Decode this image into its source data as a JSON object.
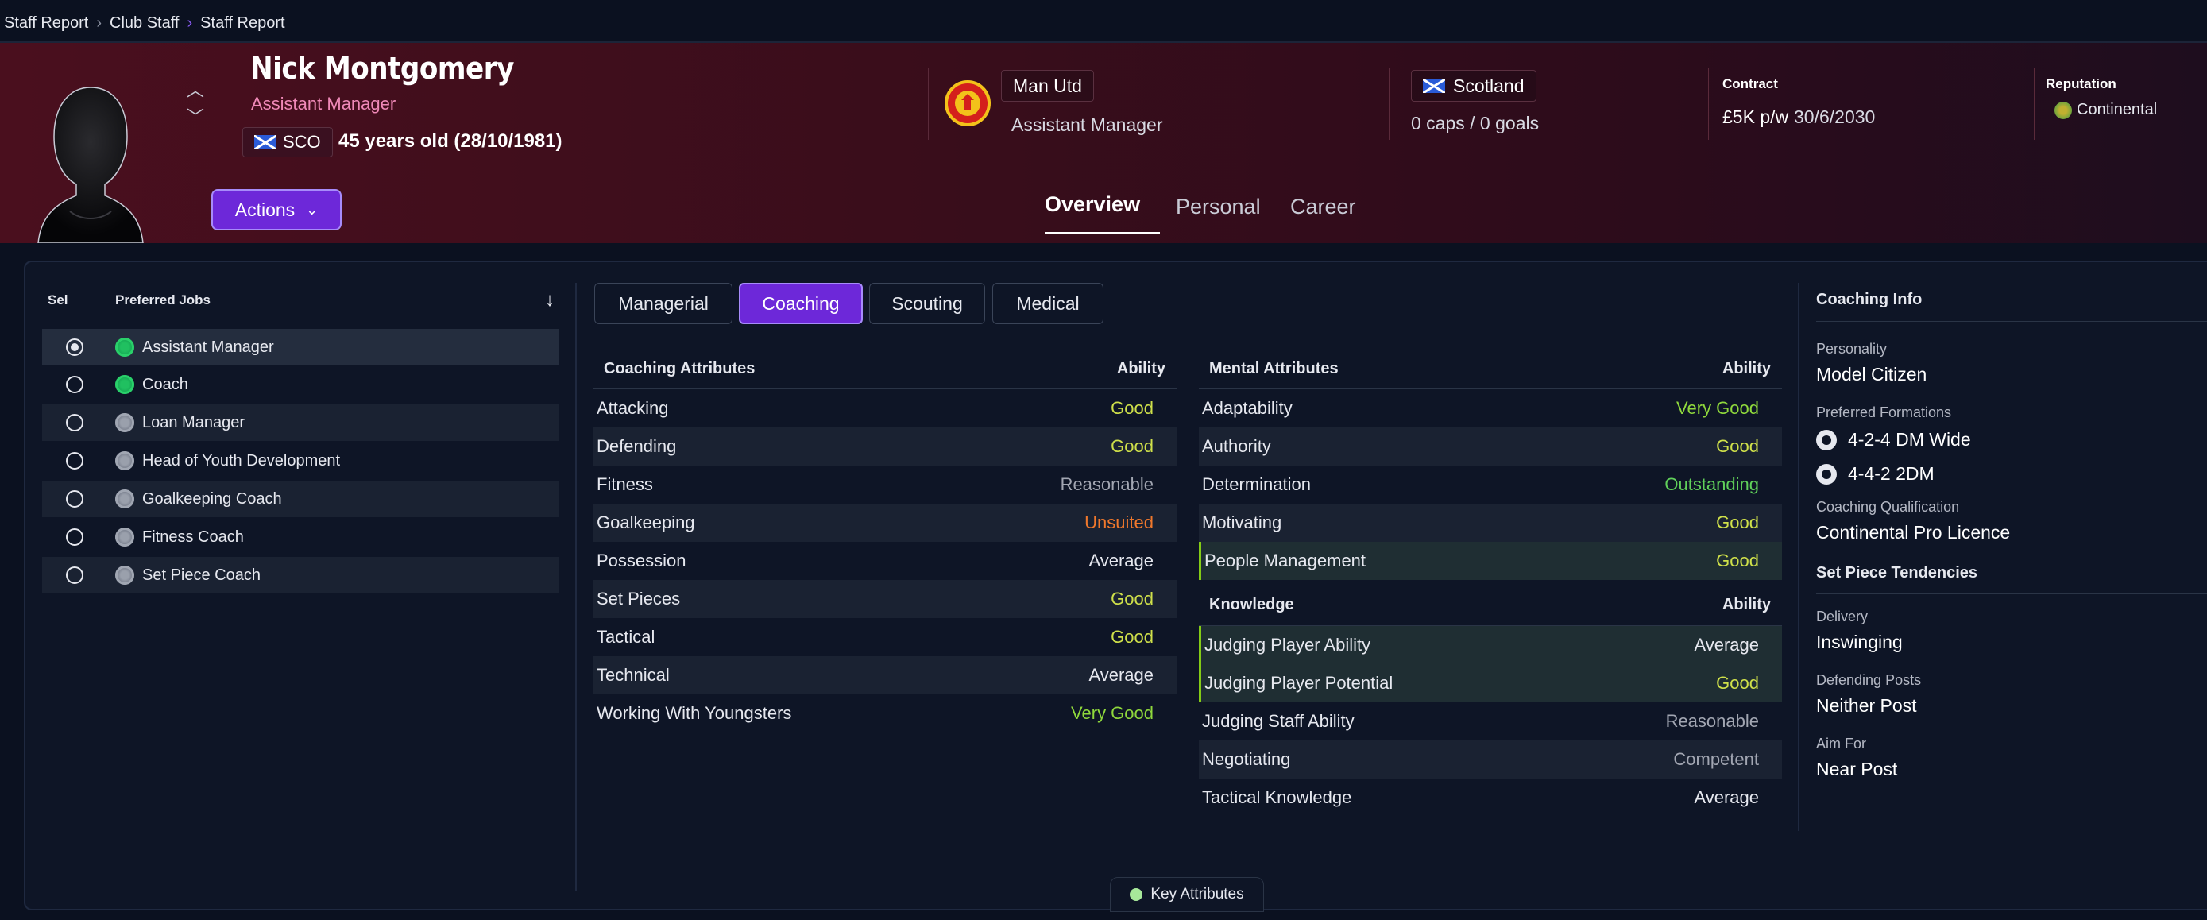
{
  "breadcrumb": [
    "Staff Report",
    "Club Staff",
    "Staff Report"
  ],
  "header": {
    "name": "Nick Montgomery",
    "role": "Assistant Manager",
    "nationality_code": "SCO",
    "age": "45 years old (28/10/1981)",
    "actions_label": "Actions",
    "club": "Man Utd",
    "club_role": "Assistant Manager",
    "nation": "Scotland",
    "caps": "0 caps / 0 goals",
    "contract_label": "Contract",
    "contract_wage": "£5K p/w",
    "contract_expiry": "30/6/2030",
    "reputation_label": "Reputation",
    "reputation": "Continental"
  },
  "tabs": [
    "Overview",
    "Personal",
    "Career"
  ],
  "jobs": {
    "col_sel": "Sel",
    "col_jobs": "Preferred Jobs",
    "items": [
      {
        "label": "Assistant Manager",
        "selected": true,
        "suited": true
      },
      {
        "label": "Coach",
        "selected": false,
        "suited": true
      },
      {
        "label": "Loan Manager",
        "selected": false,
        "suited": false
      },
      {
        "label": "Head of Youth Development",
        "selected": false,
        "suited": false
      },
      {
        "label": "Goalkeeping Coach",
        "selected": false,
        "suited": false
      },
      {
        "label": "Fitness Coach",
        "selected": false,
        "suited": false
      },
      {
        "label": "Set Piece Coach",
        "selected": false,
        "suited": false
      }
    ]
  },
  "subtabs": [
    "Managerial",
    "Coaching",
    "Scouting",
    "Medical"
  ],
  "coaching": {
    "title": "Coaching Attributes",
    "ability": "Ability",
    "rows": [
      {
        "name": "Attacking",
        "value": "Good"
      },
      {
        "name": "Defending",
        "value": "Good"
      },
      {
        "name": "Fitness",
        "value": "Reasonable"
      },
      {
        "name": "Goalkeeping",
        "value": "Unsuited"
      },
      {
        "name": "Possession",
        "value": "Average"
      },
      {
        "name": "Set Pieces",
        "value": "Good"
      },
      {
        "name": "Tactical",
        "value": "Good"
      },
      {
        "name": "Technical",
        "value": "Average"
      },
      {
        "name": "Working With Youngsters",
        "value": "Very Good"
      }
    ]
  },
  "mental": {
    "title": "Mental Attributes",
    "ability": "Ability",
    "rows": [
      {
        "name": "Adaptability",
        "value": "Very Good"
      },
      {
        "name": "Authority",
        "value": "Good"
      },
      {
        "name": "Determination",
        "value": "Outstanding"
      },
      {
        "name": "Motivating",
        "value": "Good"
      },
      {
        "name": "People Management",
        "value": "Good"
      }
    ]
  },
  "knowledge": {
    "title": "Knowledge",
    "ability": "Ability",
    "rows": [
      {
        "name": "Judging Player Ability",
        "value": "Average"
      },
      {
        "name": "Judging Player Potential",
        "value": "Good"
      },
      {
        "name": "Judging Staff Ability",
        "value": "Reasonable"
      },
      {
        "name": "Negotiating",
        "value": "Competent"
      },
      {
        "name": "Tactical Knowledge",
        "value": "Average"
      }
    ]
  },
  "coaching_info": {
    "title": "Coaching Info",
    "personality_label": "Personality",
    "personality": "Model Citizen",
    "formations_label": "Preferred Formations",
    "formations": [
      "4-2-4 DM Wide",
      "4-4-2 2DM"
    ],
    "qualification_label": "Coaching Qualification",
    "qualification": "Continental Pro Licence",
    "set_piece_title": "Set Piece Tendencies",
    "delivery_label": "Delivery",
    "delivery": "Inswinging",
    "defending_posts_label": "Defending Posts",
    "defending_posts": "Neither Post",
    "aim_for_label": "Aim For",
    "aim_for": "Near Post"
  },
  "key_attributes_label": "Key Attributes",
  "colors": {
    "accent": "#6d28d9",
    "header_bg": "#4a0f1e",
    "good": "#cfe04a",
    "unsuited": "#f0782c"
  }
}
